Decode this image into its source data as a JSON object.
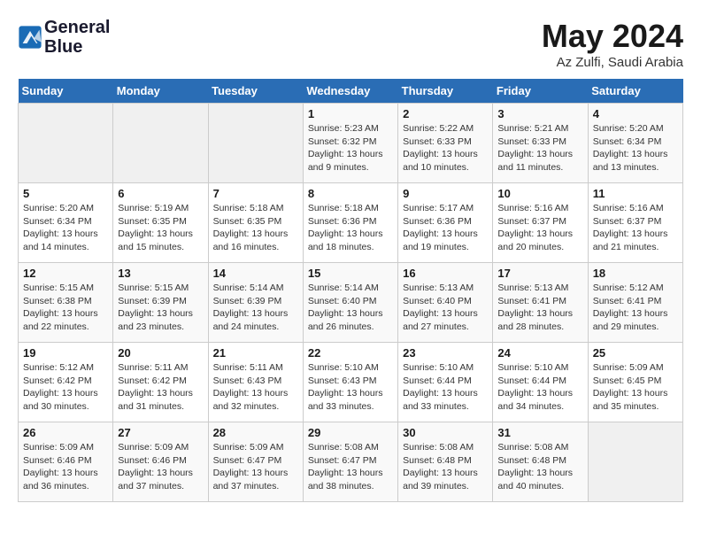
{
  "header": {
    "logo_line1": "General",
    "logo_line2": "Blue",
    "month_title": "May 2024",
    "subtitle": "Az Zulfi, Saudi Arabia"
  },
  "days_of_week": [
    "Sunday",
    "Monday",
    "Tuesday",
    "Wednesday",
    "Thursday",
    "Friday",
    "Saturday"
  ],
  "weeks": [
    [
      {
        "day": "",
        "info": ""
      },
      {
        "day": "",
        "info": ""
      },
      {
        "day": "",
        "info": ""
      },
      {
        "day": "1",
        "info": "Sunrise: 5:23 AM\nSunset: 6:32 PM\nDaylight: 13 hours\nand 9 minutes."
      },
      {
        "day": "2",
        "info": "Sunrise: 5:22 AM\nSunset: 6:33 PM\nDaylight: 13 hours\nand 10 minutes."
      },
      {
        "day": "3",
        "info": "Sunrise: 5:21 AM\nSunset: 6:33 PM\nDaylight: 13 hours\nand 11 minutes."
      },
      {
        "day": "4",
        "info": "Sunrise: 5:20 AM\nSunset: 6:34 PM\nDaylight: 13 hours\nand 13 minutes."
      }
    ],
    [
      {
        "day": "5",
        "info": "Sunrise: 5:20 AM\nSunset: 6:34 PM\nDaylight: 13 hours\nand 14 minutes."
      },
      {
        "day": "6",
        "info": "Sunrise: 5:19 AM\nSunset: 6:35 PM\nDaylight: 13 hours\nand 15 minutes."
      },
      {
        "day": "7",
        "info": "Sunrise: 5:18 AM\nSunset: 6:35 PM\nDaylight: 13 hours\nand 16 minutes."
      },
      {
        "day": "8",
        "info": "Sunrise: 5:18 AM\nSunset: 6:36 PM\nDaylight: 13 hours\nand 18 minutes."
      },
      {
        "day": "9",
        "info": "Sunrise: 5:17 AM\nSunset: 6:36 PM\nDaylight: 13 hours\nand 19 minutes."
      },
      {
        "day": "10",
        "info": "Sunrise: 5:16 AM\nSunset: 6:37 PM\nDaylight: 13 hours\nand 20 minutes."
      },
      {
        "day": "11",
        "info": "Sunrise: 5:16 AM\nSunset: 6:37 PM\nDaylight: 13 hours\nand 21 minutes."
      }
    ],
    [
      {
        "day": "12",
        "info": "Sunrise: 5:15 AM\nSunset: 6:38 PM\nDaylight: 13 hours\nand 22 minutes."
      },
      {
        "day": "13",
        "info": "Sunrise: 5:15 AM\nSunset: 6:39 PM\nDaylight: 13 hours\nand 23 minutes."
      },
      {
        "day": "14",
        "info": "Sunrise: 5:14 AM\nSunset: 6:39 PM\nDaylight: 13 hours\nand 24 minutes."
      },
      {
        "day": "15",
        "info": "Sunrise: 5:14 AM\nSunset: 6:40 PM\nDaylight: 13 hours\nand 26 minutes."
      },
      {
        "day": "16",
        "info": "Sunrise: 5:13 AM\nSunset: 6:40 PM\nDaylight: 13 hours\nand 27 minutes."
      },
      {
        "day": "17",
        "info": "Sunrise: 5:13 AM\nSunset: 6:41 PM\nDaylight: 13 hours\nand 28 minutes."
      },
      {
        "day": "18",
        "info": "Sunrise: 5:12 AM\nSunset: 6:41 PM\nDaylight: 13 hours\nand 29 minutes."
      }
    ],
    [
      {
        "day": "19",
        "info": "Sunrise: 5:12 AM\nSunset: 6:42 PM\nDaylight: 13 hours\nand 30 minutes."
      },
      {
        "day": "20",
        "info": "Sunrise: 5:11 AM\nSunset: 6:42 PM\nDaylight: 13 hours\nand 31 minutes."
      },
      {
        "day": "21",
        "info": "Sunrise: 5:11 AM\nSunset: 6:43 PM\nDaylight: 13 hours\nand 32 minutes."
      },
      {
        "day": "22",
        "info": "Sunrise: 5:10 AM\nSunset: 6:43 PM\nDaylight: 13 hours\nand 33 minutes."
      },
      {
        "day": "23",
        "info": "Sunrise: 5:10 AM\nSunset: 6:44 PM\nDaylight: 13 hours\nand 33 minutes."
      },
      {
        "day": "24",
        "info": "Sunrise: 5:10 AM\nSunset: 6:44 PM\nDaylight: 13 hours\nand 34 minutes."
      },
      {
        "day": "25",
        "info": "Sunrise: 5:09 AM\nSunset: 6:45 PM\nDaylight: 13 hours\nand 35 minutes."
      }
    ],
    [
      {
        "day": "26",
        "info": "Sunrise: 5:09 AM\nSunset: 6:46 PM\nDaylight: 13 hours\nand 36 minutes."
      },
      {
        "day": "27",
        "info": "Sunrise: 5:09 AM\nSunset: 6:46 PM\nDaylight: 13 hours\nand 37 minutes."
      },
      {
        "day": "28",
        "info": "Sunrise: 5:09 AM\nSunset: 6:47 PM\nDaylight: 13 hours\nand 37 minutes."
      },
      {
        "day": "29",
        "info": "Sunrise: 5:08 AM\nSunset: 6:47 PM\nDaylight: 13 hours\nand 38 minutes."
      },
      {
        "day": "30",
        "info": "Sunrise: 5:08 AM\nSunset: 6:48 PM\nDaylight: 13 hours\nand 39 minutes."
      },
      {
        "day": "31",
        "info": "Sunrise: 5:08 AM\nSunset: 6:48 PM\nDaylight: 13 hours\nand 40 minutes."
      },
      {
        "day": "",
        "info": ""
      }
    ]
  ]
}
